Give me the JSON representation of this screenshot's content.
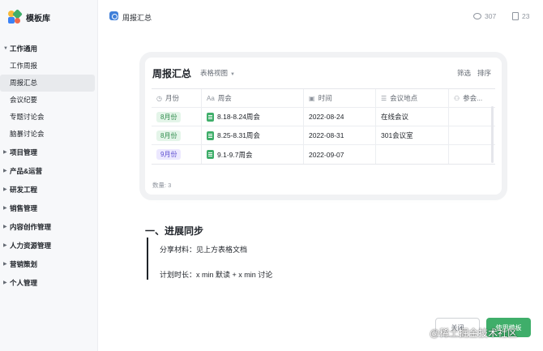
{
  "brand": {
    "name": "模板库"
  },
  "sidebar": {
    "groups": [
      {
        "label": "工作通用",
        "expanded": true,
        "items": [
          "工作周报",
          "周报汇总",
          "会议纪要",
          "专题讨论会",
          "脑暴讨论会"
        ],
        "active": "周报汇总"
      },
      {
        "label": "项目管理"
      },
      {
        "label": "产品&运营"
      },
      {
        "label": "研发工程"
      },
      {
        "label": "销售管理"
      },
      {
        "label": "内容创作管理"
      },
      {
        "label": "人力资源管理"
      },
      {
        "label": "营销策划"
      },
      {
        "label": "个人管理"
      }
    ]
  },
  "header": {
    "title": "周报汇总",
    "views": "307",
    "pages": "23"
  },
  "table": {
    "title": "周报汇总",
    "view_label": "表格视图",
    "filter_label": "筛选",
    "sort_label": "排序",
    "columns": [
      {
        "icon": "◷",
        "label": "月份"
      },
      {
        "icon": "Aa",
        "label": "周会"
      },
      {
        "icon": "▣",
        "label": "时间"
      },
      {
        "icon": "☰",
        "label": "会议地点"
      },
      {
        "icon": "⚇",
        "label": "参会..."
      }
    ],
    "rows": [
      {
        "month": "8月份",
        "month_color": "green",
        "meeting": "8.18-8.24周会",
        "date": "2022-08-24",
        "location": "在线会议",
        "attendees": ""
      },
      {
        "month": "8月份",
        "month_color": "green",
        "meeting": "8.25-8.31周会",
        "date": "2022-08-31",
        "location": "301会议室",
        "attendees": ""
      },
      {
        "month": "9月份",
        "month_color": "purple",
        "meeting": "9.1-9.7周会",
        "date": "2022-09-07",
        "location": "",
        "attendees": ""
      }
    ],
    "count_label": "数量: 3"
  },
  "content": {
    "section_title": "一、进展同步",
    "line1": "分享材料：见上方表格文档",
    "line2": "计划时长：x min 默读 + x min 讨论"
  },
  "buttons": {
    "close": "关闭",
    "use": "使用模板"
  },
  "watermark": "@稀土掘金技术社区",
  "colors": {
    "accent": "#3fae6a",
    "sidebar_bg": "#f7f8fa"
  }
}
